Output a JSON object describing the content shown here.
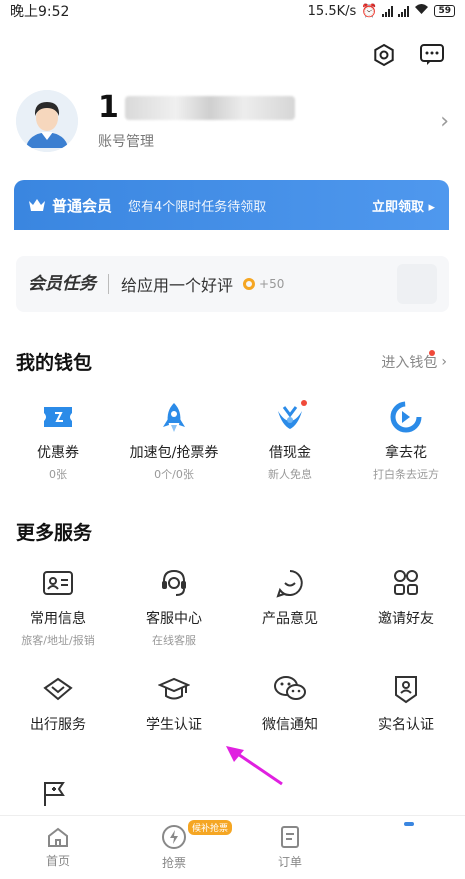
{
  "status_bar": {
    "time": "晚上9:52",
    "speed": "15.5K/s",
    "battery": "59"
  },
  "header": {
    "settings_icon": "gear-icon",
    "message_icon": "message-icon"
  },
  "profile": {
    "name_visible": "1",
    "subtitle": "账号管理"
  },
  "member_bar": {
    "badge": "普通会员",
    "text": "您有4个限时任务待领取",
    "cta": "立即领取 ▸"
  },
  "task_card": {
    "brand": "会员任务",
    "text": "给应用一个好评",
    "points": "+50"
  },
  "wallet": {
    "title": "我的钱包",
    "link": "进入钱包",
    "items": [
      {
        "label": "优惠券",
        "sub": "0张",
        "icon": "ticket-icon"
      },
      {
        "label": "加速包/抢票券",
        "sub": "0个/0张",
        "icon": "rocket-icon"
      },
      {
        "label": "借现金",
        "sub": "新人免息",
        "icon": "loan-icon"
      },
      {
        "label": "拿去花",
        "sub": "打白条去远方",
        "icon": "credit-icon"
      }
    ]
  },
  "services": {
    "title": "更多服务",
    "items": [
      {
        "label": "常用信息",
        "sub": "旅客/地址/报销",
        "icon": "id-card-icon"
      },
      {
        "label": "客服中心",
        "sub": "在线客服",
        "icon": "headset-icon"
      },
      {
        "label": "产品意见",
        "sub": "",
        "icon": "feedback-icon"
      },
      {
        "label": "邀请好友",
        "sub": "",
        "icon": "friends-icon"
      },
      {
        "label": "出行服务",
        "sub": "",
        "icon": "diamond-icon"
      },
      {
        "label": "学生认证",
        "sub": "",
        "icon": "graduation-cap-icon"
      },
      {
        "label": "微信通知",
        "sub": "",
        "icon": "wechat-icon"
      },
      {
        "label": "实名认证",
        "sub": "",
        "icon": "badge-icon"
      }
    ]
  },
  "tabbar": {
    "items": [
      {
        "label": "首页",
        "icon": "home-icon"
      },
      {
        "label": "抢票",
        "icon": "lightning-icon",
        "badge": "候补抢票"
      },
      {
        "label": "订单",
        "icon": "order-icon"
      }
    ]
  },
  "colors": {
    "accent": "#3a86e0",
    "red_dot": "#f04a3a",
    "coin": "#f5a623",
    "annotation_arrow": "#e020e0"
  }
}
